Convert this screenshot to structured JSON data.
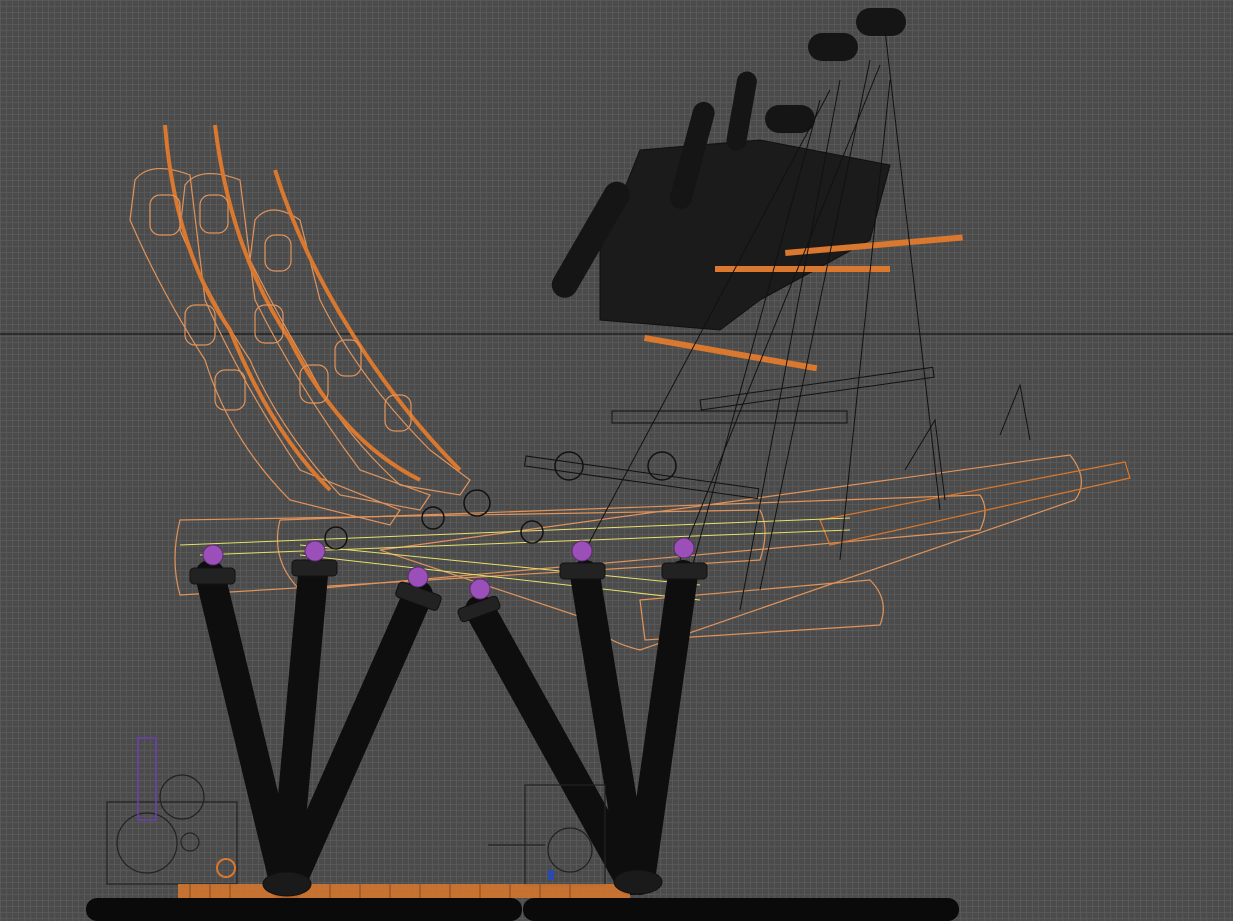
{
  "viewport": {
    "type": "cad-wireframe-viewport",
    "view": "side-elevation",
    "colors": {
      "background": "#4b4b4b",
      "grid": "#5a5a5a",
      "grid_axis": "#222222",
      "black_part": "#111111",
      "orange_outline": "#e0935a",
      "orange_part": "#d9782e",
      "yellow_line": "#e8e06a",
      "purple_joint": "#9b4fb8",
      "violet_rod": "#6a3fb0"
    },
    "legs": {
      "count": 6
    },
    "seat_poses": {
      "count": 3
    }
  }
}
